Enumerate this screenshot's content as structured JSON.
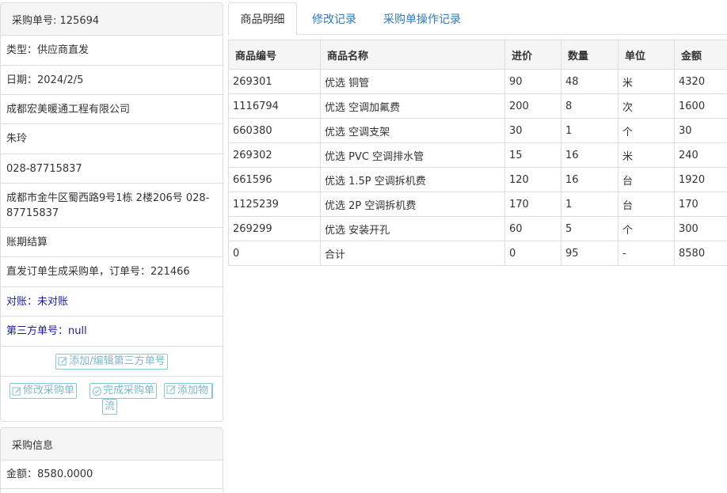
{
  "order": {
    "heading": "采购单号: 125694",
    "type": "类型：供应商直发",
    "date": "日期：2024/2/5",
    "company": "成都宏美暖通工程有限公司",
    "contact": "朱玲",
    "phone": "028-87715837",
    "address": "成都市金牛区蜀西路9号1栋 2楼206号 028-87715837",
    "payment": "账期结算",
    "note": "直发订单生成采购单，订单号：221466",
    "reconcile": "对账：未对账",
    "third_party": "第三方单号：null",
    "btn_third_party": "添加/编辑第三方单号",
    "btn_modify": "修改采购单",
    "btn_complete": "完成采购单",
    "btn_logistics_1": "添加物",
    "btn_logistics_2": "流"
  },
  "info": {
    "heading": "采购信息",
    "amount": "金额：8580.0000"
  },
  "tabs": [
    {
      "label": "商品明细"
    },
    {
      "label": "修改记录"
    },
    {
      "label": "采购单操作记录"
    }
  ],
  "table": {
    "headers": [
      "商品编号",
      "商品名称",
      "进价",
      "数量",
      "单位",
      "金额"
    ],
    "rows": [
      [
        "269301",
        "优选 铜管",
        "90",
        "48",
        "米",
        "4320"
      ],
      [
        "1116794",
        "优选 空调加氟费",
        "200",
        "8",
        "次",
        "1600"
      ],
      [
        "660380",
        "优选 空调支架",
        "30",
        "1",
        "个",
        "30"
      ],
      [
        "269302",
        "优选 PVC 空调排水管",
        "15",
        "16",
        "米",
        "240"
      ],
      [
        "661596",
        "优选 1.5P 空调拆机费",
        "120",
        "16",
        "台",
        "1920"
      ],
      [
        "1125239",
        "优选 2P 空调拆机费",
        "170",
        "1",
        "台",
        "170"
      ],
      [
        "269299",
        "优选 安装开孔",
        "60",
        "5",
        "个",
        "300"
      ],
      [
        "0",
        "合计",
        "0",
        "95",
        "-",
        "8580"
      ]
    ]
  }
}
